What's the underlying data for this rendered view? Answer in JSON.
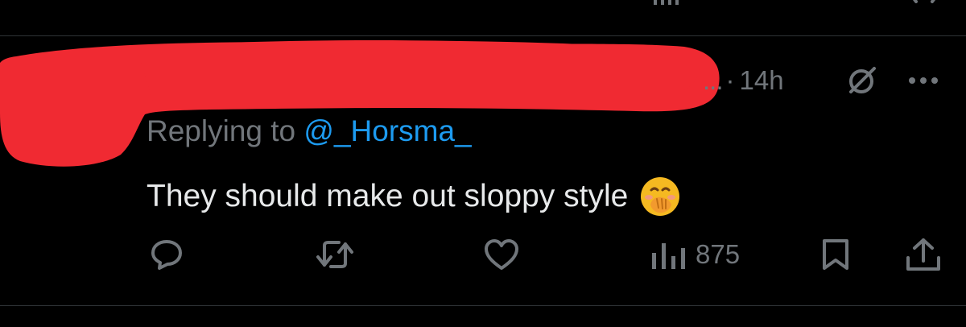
{
  "tweet": {
    "author_truncation": "...",
    "separator": "·",
    "time": "14h",
    "replying_label": "Replying to",
    "replying_handle": "@_Horsma_",
    "text": "They should make out sloppy style"
  },
  "actions": {
    "views": "875"
  },
  "icons": [
    "grok-icon",
    "more-icon",
    "reply-icon",
    "retweet-icon",
    "like-icon",
    "views-icon",
    "bookmark-icon",
    "share-icon",
    "face-with-hand-over-mouth-emoji"
  ],
  "colors": {
    "background": "#000000",
    "text": "#e7e9ea",
    "muted": "#71767b",
    "link": "#1d9bf0",
    "redaction": "#f02a32",
    "divider": "#2f3336"
  }
}
